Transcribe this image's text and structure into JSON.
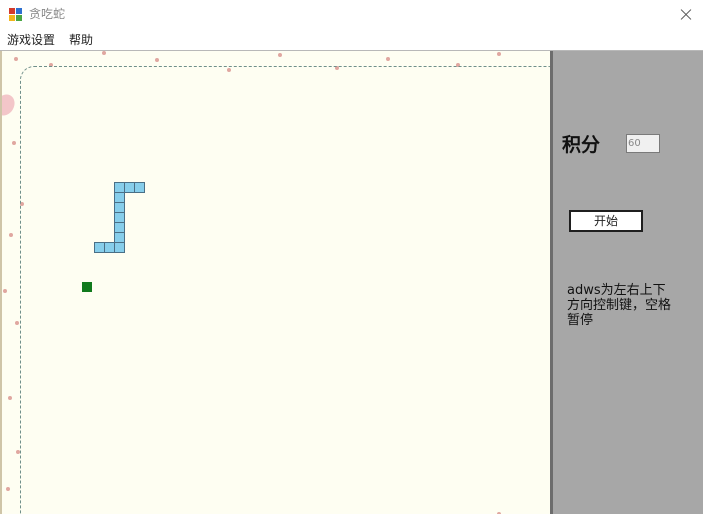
{
  "window": {
    "title": "贪吃蛇",
    "icon": "app-icon",
    "close_icon": "close-icon"
  },
  "menu": {
    "items": [
      "游戏设置",
      "帮助"
    ]
  },
  "game": {
    "snake_color": "#87ceeb",
    "food_color": "#117a1d",
    "board_background": "#fefef2"
  },
  "panel": {
    "score_label": "积分",
    "score_value": "60",
    "start_label": "开始",
    "hint": "adws为左右上下方向控制键，空格暂停"
  }
}
